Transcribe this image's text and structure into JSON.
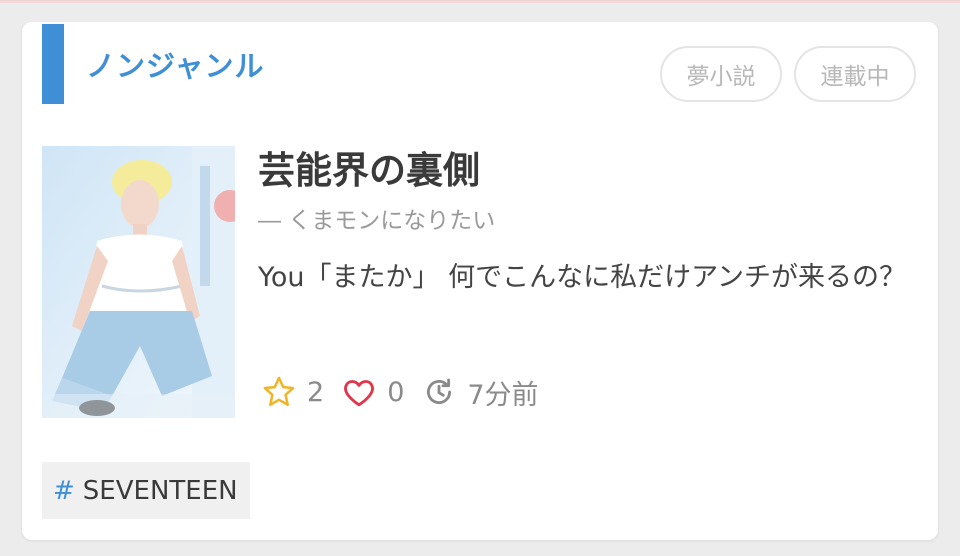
{
  "card": {
    "genre": "ノンジャンル",
    "tags": [
      "夢小説",
      "連載中"
    ],
    "title": "芸能界の裏側",
    "author": "― くまモンになりたい",
    "summary": "You「またか」 何でこんなに私だけアンチが来るの？",
    "stats": {
      "stars": "2",
      "likes": "0",
      "updated": "7分前"
    },
    "hashtag_symbol": "#",
    "hashtag": "SEVENTEEN"
  },
  "colors": {
    "accent": "#3f8fd6",
    "star": "#f0b429",
    "heart": "#e0354a",
    "muted": "#8a8a8a"
  },
  "icons": {
    "star": "star-icon",
    "heart": "heart-icon",
    "updated": "refresh-clock-icon"
  }
}
